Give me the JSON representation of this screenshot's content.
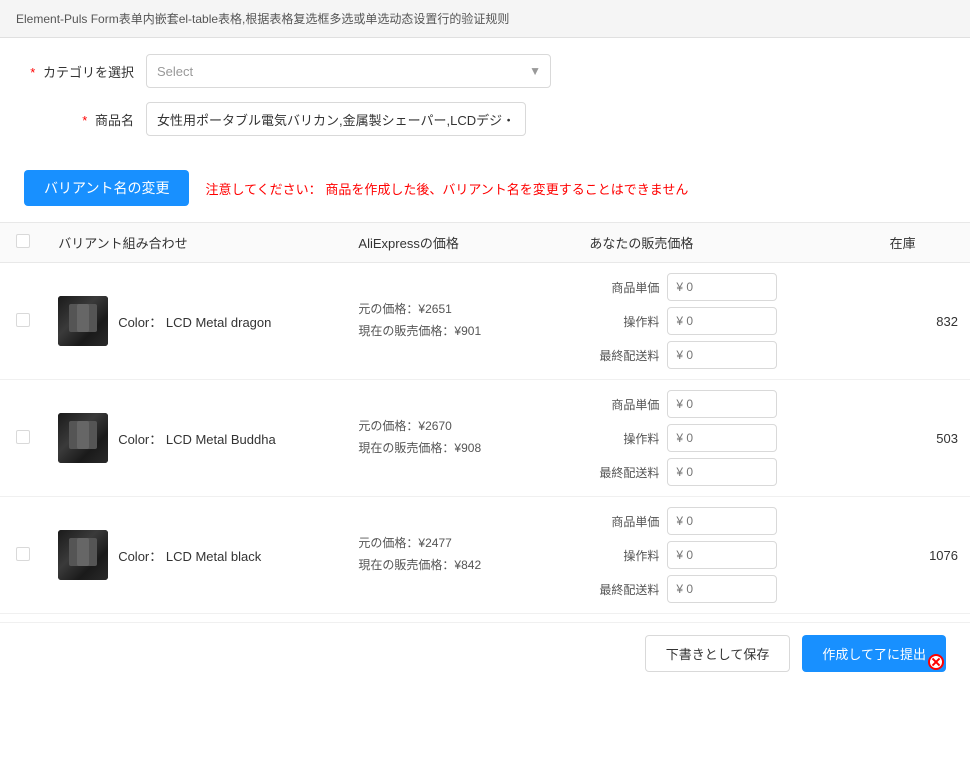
{
  "page": {
    "title": "Element-Puls Form表单内嵌套el-table表格,根据表格复选框多选或单选动态设置行的验证规则"
  },
  "form": {
    "category_label": "カテゴリを選択",
    "category_placeholder": "Select",
    "product_name_label": "商品名",
    "product_name_value": "女性用ポータブル電気バリカン,金属製シェーパー,LCDデジ・",
    "required_star": "*"
  },
  "variant_section": {
    "change_button_label": "バリアント名の変更",
    "warning_prefix": "注意してください：",
    "warning_text": "商品を作成した後、バリアント名を変更することはできません"
  },
  "table": {
    "headers": {
      "checkbox": "",
      "variant": "バリアント組み合わせ",
      "aliexpress_price": "AliExpressの価格",
      "selling_price": "あなたの販売価格",
      "stock": "在庫"
    },
    "price_labels": {
      "unit": "商品単価",
      "fee": "操作料",
      "shipping": "最終配送料"
    },
    "rows": [
      {
        "id": 1,
        "color_label": "Color：",
        "color_name": "LCD Metal dragon",
        "original_price_label": "元の価格：",
        "original_price": "¥2651",
        "current_price_label": "現在の販売価格：",
        "current_price": "¥901",
        "unit_price": "0",
        "fee": "0",
        "shipping": "0",
        "stock": "832"
      },
      {
        "id": 2,
        "color_label": "Color：",
        "color_name": "LCD Metal Buddha",
        "original_price_label": "元の価格：",
        "original_price": "¥2670",
        "current_price_label": "現在の販売価格：",
        "current_price": "¥908",
        "unit_price": "0",
        "fee": "0",
        "shipping": "0",
        "stock": "503"
      },
      {
        "id": 3,
        "color_label": "Color：",
        "color_name": "LCD Metal black",
        "original_price_label": "元の価格：",
        "original_price": "¥2477",
        "current_price_label": "現在の販売価格：",
        "current_price": "¥842",
        "unit_price": "0",
        "fee": "0",
        "shipping": "0",
        "stock": "1076"
      }
    ]
  },
  "footer": {
    "save_draft_label": "下書きとして保存",
    "submit_label": "作成して了に提出"
  },
  "icons": {
    "chevron_down": "▼",
    "yen": "¥"
  }
}
